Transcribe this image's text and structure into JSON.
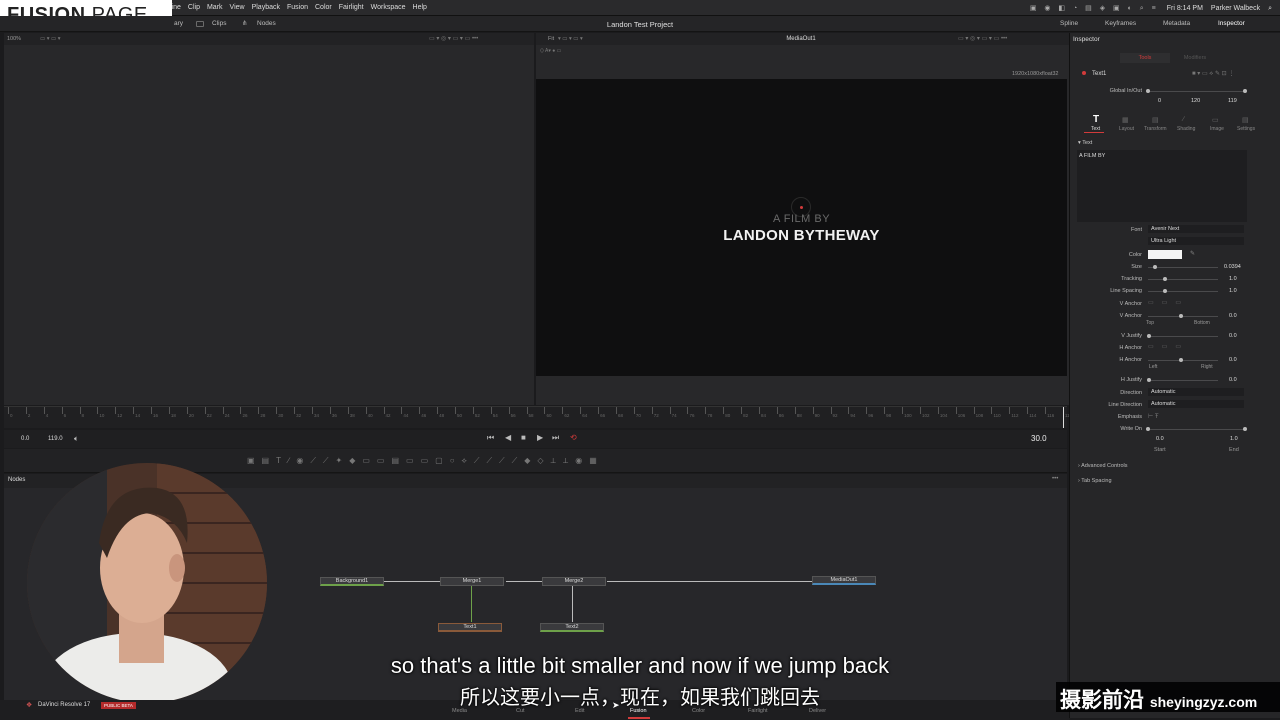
{
  "overlay_logo": {
    "bold": "FUSION",
    "light": "PAGE"
  },
  "menubar": {
    "items": [
      "line",
      "Clip",
      "Mark",
      "View",
      "Playback",
      "Fusion",
      "Color",
      "Fairlight",
      "Workspace",
      "Help"
    ],
    "time": "Fri 8:14 PM",
    "user": "Parker Walbeck"
  },
  "toolbar": {
    "left": [
      "ary",
      "Clips",
      "Nodes"
    ],
    "project_title": "Landon Test Project",
    "right": [
      "Spline",
      "Keyframes",
      "Metadata",
      "Inspector"
    ]
  },
  "viewer_left": {
    "zoom": "100%"
  },
  "viewer_right": {
    "fit": "Fit",
    "title": "MediaOut1",
    "resolution": "1920x1080xfloat32"
  },
  "canvas": {
    "line1": "A FILM BY",
    "line2": "LANDON BYTHEWAY"
  },
  "timeline": {
    "ticks": [
      "0",
      "2",
      "4",
      "6",
      "8",
      "10",
      "12",
      "14",
      "16",
      "18",
      "20",
      "22",
      "24",
      "26",
      "28",
      "30",
      "32",
      "34",
      "36",
      "38",
      "40",
      "42",
      "44",
      "46",
      "48",
      "50",
      "52",
      "54",
      "56",
      "58",
      "60",
      "62",
      "64",
      "66",
      "68",
      "70",
      "72",
      "74",
      "76",
      "78",
      "80",
      "82",
      "84",
      "86",
      "88",
      "90",
      "92",
      "94",
      "96",
      "98",
      "100",
      "102",
      "104",
      "106",
      "108",
      "110",
      "112",
      "114",
      "116",
      "118"
    ]
  },
  "transport": {
    "start": "0.0",
    "end": "119.0",
    "fps": "30.0"
  },
  "nodes_panel": {
    "title": "Nodes",
    "nodes": {
      "background": "Background1",
      "merge1": "Merge1",
      "merge2": "Merge2",
      "mediaout": "MediaOut1",
      "text1": "Text1",
      "text2": "Text2"
    }
  },
  "inspector": {
    "title": "Inspector",
    "tabs_top": [
      "Tools",
      "Modifiers"
    ],
    "tool_name": "Text1",
    "global_inout_label": "Global In/Out",
    "global_values": [
      "0",
      "120",
      "119"
    ],
    "subtabs": [
      "Text",
      "Layout",
      "Transform",
      "Shading",
      "Image",
      "Settings"
    ],
    "section": "Text",
    "styled_text": "A FILM BY",
    "rows": {
      "font_label": "Font",
      "font_value": "Avenir Next",
      "font_style": "Ultra Light",
      "color_label": "Color",
      "size_label": "Size",
      "size_value": "0.0394",
      "tracking_label": "Tracking",
      "tracking_value": "1.0",
      "line_spacing_label": "Line Spacing",
      "line_spacing_value": "1.0",
      "vanchor_label": "V Anchor",
      "vanchor2_label": "V Anchor",
      "vanchor2_value": "0.0",
      "top": "Top",
      "bottom": "Bottom",
      "vjustify_label": "V Justify",
      "vjustify_value": "0.0",
      "hanchor_label": "H Anchor",
      "hanchor2_label": "H Anchor",
      "hanchor2_value": "0.0",
      "left": "Left",
      "right": "Right",
      "hjustify_label": "H Justify",
      "hjustify_value": "0.0",
      "direction_label": "Direction",
      "direction_value": "Automatic",
      "line_direction_label": "Line Direction",
      "line_direction_value": "Automatic",
      "emphasis_label": "Emphasis",
      "write_on_label": "Write On",
      "write_on_start": "0.0",
      "write_on_end": "1.0",
      "start": "Start",
      "end": "End"
    },
    "collapsed": [
      "Advanced Controls",
      "Tab Spacing"
    ]
  },
  "pages": [
    "Media",
    "Cut",
    "Edit",
    "Fusion",
    "Color",
    "Fairlight",
    "Deliver"
  ],
  "app": {
    "name": "DaVinci Resolve 17",
    "badge": "PUBLIC BETA"
  },
  "subtitles": {
    "en": "so that's a little bit smaller and now if we jump back",
    "zh": "所以这要小一点，现在，如果我们跳回去"
  },
  "watermark": {
    "cn": "摄影前沿",
    "url": "sheyingzyz.com"
  },
  "colors": {
    "accent_red": "#d23b3b",
    "node_green": "#6ea14a"
  }
}
